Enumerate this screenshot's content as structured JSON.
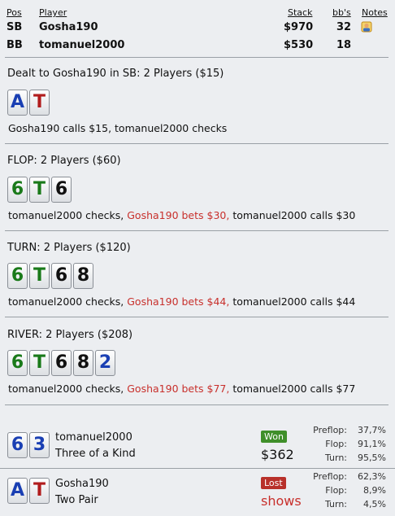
{
  "header": {
    "pos_label": "Pos",
    "player_label": "Player",
    "stack_label": "Stack",
    "bbs_label": "bb's",
    "notes_label": "Notes",
    "rows": [
      {
        "pos": "SB",
        "player": "Gosha190",
        "stack": "$970",
        "bbs": "32",
        "has_note": true
      },
      {
        "pos": "BB",
        "player": "tomanuel2000",
        "stack": "$530",
        "bbs": "18",
        "has_note": false
      }
    ]
  },
  "preflop": {
    "title": "Dealt to Gosha190 in SB: 2 Players ($15)",
    "cards": [
      {
        "rank": "A",
        "suit": "diamonds"
      },
      {
        "rank": "T",
        "suit": "hearts"
      }
    ],
    "action": "Gosha190 calls $15, tomanuel2000 checks"
  },
  "flop": {
    "title": "FLOP: 2 Players ($60)",
    "cards": [
      {
        "rank": "6",
        "suit": "clubs"
      },
      {
        "rank": "T",
        "suit": "clubs"
      },
      {
        "rank": "6",
        "suit": "spades"
      }
    ],
    "action_a": "tomanuel2000 checks, ",
    "action_b": "Gosha190 bets $30,",
    "action_c": " tomanuel2000 calls $30"
  },
  "turn": {
    "title": "TURN: 2 Players ($120)",
    "cards": [
      {
        "rank": "6",
        "suit": "clubs"
      },
      {
        "rank": "T",
        "suit": "clubs"
      },
      {
        "rank": "6",
        "suit": "spades"
      },
      {
        "rank": "8",
        "suit": "spades"
      }
    ],
    "action_a": "tomanuel2000 checks, ",
    "action_b": "Gosha190 bets $44,",
    "action_c": " tomanuel2000 calls $44"
  },
  "river": {
    "title": "RIVER: 2 Players ($208)",
    "cards": [
      {
        "rank": "6",
        "suit": "clubs"
      },
      {
        "rank": "T",
        "suit": "clubs"
      },
      {
        "rank": "6",
        "suit": "spades"
      },
      {
        "rank": "8",
        "suit": "spades"
      },
      {
        "rank": "2",
        "suit": "diamonds"
      }
    ],
    "action_a": "tomanuel2000 checks, ",
    "action_b": "Gosha190 bets $77,",
    "action_c": " tomanuel2000 calls $77"
  },
  "results": [
    {
      "player": "tomanuel2000",
      "hand": "Three of a Kind",
      "cards": [
        {
          "rank": "6",
          "suit": "diamonds"
        },
        {
          "rank": "3",
          "suit": "diamonds"
        }
      ],
      "outcome": "Won",
      "amount": "$362",
      "stats": [
        {
          "label": "Preflop:",
          "value": "37,7%"
        },
        {
          "label": "Flop:",
          "value": "91,1%"
        },
        {
          "label": "Turn:",
          "value": "95,5%"
        }
      ]
    },
    {
      "player": "Gosha190",
      "hand": "Two Pair",
      "cards": [
        {
          "rank": "A",
          "suit": "diamonds"
        },
        {
          "rank": "T",
          "suit": "hearts"
        }
      ],
      "outcome": "Lost",
      "amount": "shows",
      "stats": [
        {
          "label": "Preflop:",
          "value": "62,3%"
        },
        {
          "label": "Flop:",
          "value": "8,9%"
        },
        {
          "label": "Turn:",
          "value": "4,5%"
        }
      ]
    }
  ],
  "colors": {
    "bet_text": "#c8302c",
    "won": "#3f8f2a",
    "lost": "#b8302a",
    "clubs": "#1a7a1a",
    "diamonds": "#1a3fb3",
    "hearts": "#b11d1d",
    "spades": "#111111"
  }
}
